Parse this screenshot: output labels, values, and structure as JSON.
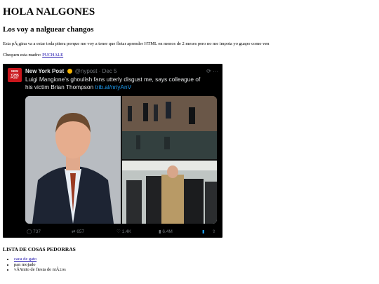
{
  "page": {
    "heading": "HOLA NALGONES",
    "subheading": "Los voy a nalguear changos",
    "paragraph": "Esta pÃ¡gina va a estar toda pitera porque me voy a tener que fletar aprender HTML en menos de 2 meses pero no me impota yo guapo como ven",
    "check_prefix": "Chequen esta madre: ",
    "check_link": "PUCHALE",
    "list_title": "LISTA DE COSAS PEDORRAS",
    "list_items": [
      "caca de gato",
      "pan mojado",
      "vÃ³mito de fiesta de niÃ±os"
    ]
  },
  "tweet": {
    "avatar_text": "NEW YORK POST",
    "author": "New York Post",
    "handle": "@nypost · Dec 5",
    "text": "Luigi Mangione's ghoulish fans utterly disgust me, says colleague of his victim Brian Thompson ",
    "link": "trib.al/nriyAnV",
    "replies": "737",
    "retweets": "657",
    "likes": "1.4K",
    "views": "6.4M"
  }
}
